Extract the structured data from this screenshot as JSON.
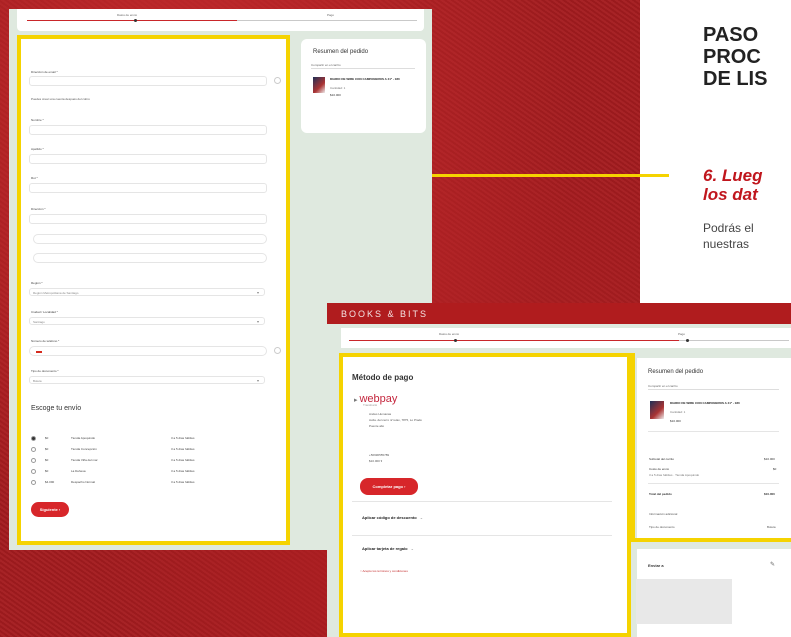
{
  "slide": {
    "title_lines": [
      "PASO",
      "PROC",
      "DE LIS"
    ],
    "step_title_lines": [
      "6. Lueg",
      "los dat"
    ],
    "step_desc_lines": [
      "Podrás el",
      "nuestras"
    ]
  },
  "checkout_form": {
    "progress": {
      "step1": "Datos de envío",
      "step2": "Pago"
    },
    "fields": {
      "email_label": "Dirección de email *",
      "account_help": "Puedes crear una cuenta después del cobro",
      "nombre_label": "Nombre *",
      "apellido_label": "Apellido *",
      "rut_label": "Rut *",
      "direccion_label": "Dirección *",
      "region_label": "Región *",
      "region_value": "Región Metropolitana de Santiago",
      "ciudad_label": "Ciudad / Localidad *",
      "ciudad_value": "Santiago",
      "telefono_label": "Número de teléfono *",
      "tipo_doc_label": "Tipo de documento *",
      "tipo_doc_value": "Boleta"
    },
    "shipping": {
      "title": "Escoge tu envío",
      "options": [
        {
          "price": "$0",
          "name": "Tienda Apoquindo",
          "time": "3 a 5 días hábiles",
          "selected": true
        },
        {
          "price": "$0",
          "name": "Tienda Concepción",
          "time": "3 a 5 días hábiles",
          "selected": false
        },
        {
          "price": "$0",
          "name": "Tienda Viña del mar",
          "time": "3 a 5 días hábiles",
          "selected": false
        },
        {
          "price": "$0",
          "name": "La Dehesa",
          "time": "3 a 5 días hábiles",
          "selected": false
        },
        {
          "price": "$4.090",
          "name": "Despacho Normal",
          "time": "3 a 5 días hábiles",
          "selected": false
        }
      ]
    },
    "next_button": "Siguiente ›"
  },
  "summary1": {
    "title": "Resumen del pedido",
    "select": "Compartir en el carrito",
    "book_title": "DIARIO DE WIRE CON CAMPANEROS A 41º - 180",
    "book_qty": "Cantidad: 1",
    "book_price": "$10.000"
  },
  "payment": {
    "brand": "BOOKS & BITS",
    "progress": {
      "step1": "Datos de envío",
      "step2": "Pago"
    },
    "title": "Método de pago",
    "webpay": "webpay",
    "webpay_sub": "Transbank",
    "lines": [
      "Andes Humanas",
      "Avda. del cerro 4/ relax, 7875, Lo Prado",
      "Puente alto",
      "+56996555789",
      "$10.000 ▾"
    ],
    "pay_button": "Completar pago ›",
    "discount_link": "Aplicar código de descuento",
    "gift_link": "Aplicar tarjeta de regalo",
    "terms": "Acepto los términos y condiciones"
  },
  "summary2": {
    "title": "Resumen del pedido",
    "select": "Compartir en el carrito",
    "book_title": "DIARIO DE WIRE CON CAMPANEROS A 41º - 180",
    "book_qty": "Cantidad: 1",
    "book_price": "$10.000",
    "subtotal_label": "Subtotal del carrito",
    "subtotal_value": "$10.000",
    "shipping_label": "Costo de envío",
    "shipping_value": "$0",
    "shipping_note": "3 a 5 días hábiles · Tienda Apoquindo",
    "total_label": "Total del pedido",
    "total_value": "$10.000",
    "extra_info": "Información adicional",
    "doc_label": "Tipo de documento",
    "doc_value": "Boleta",
    "ship_to": "Enviar a"
  }
}
